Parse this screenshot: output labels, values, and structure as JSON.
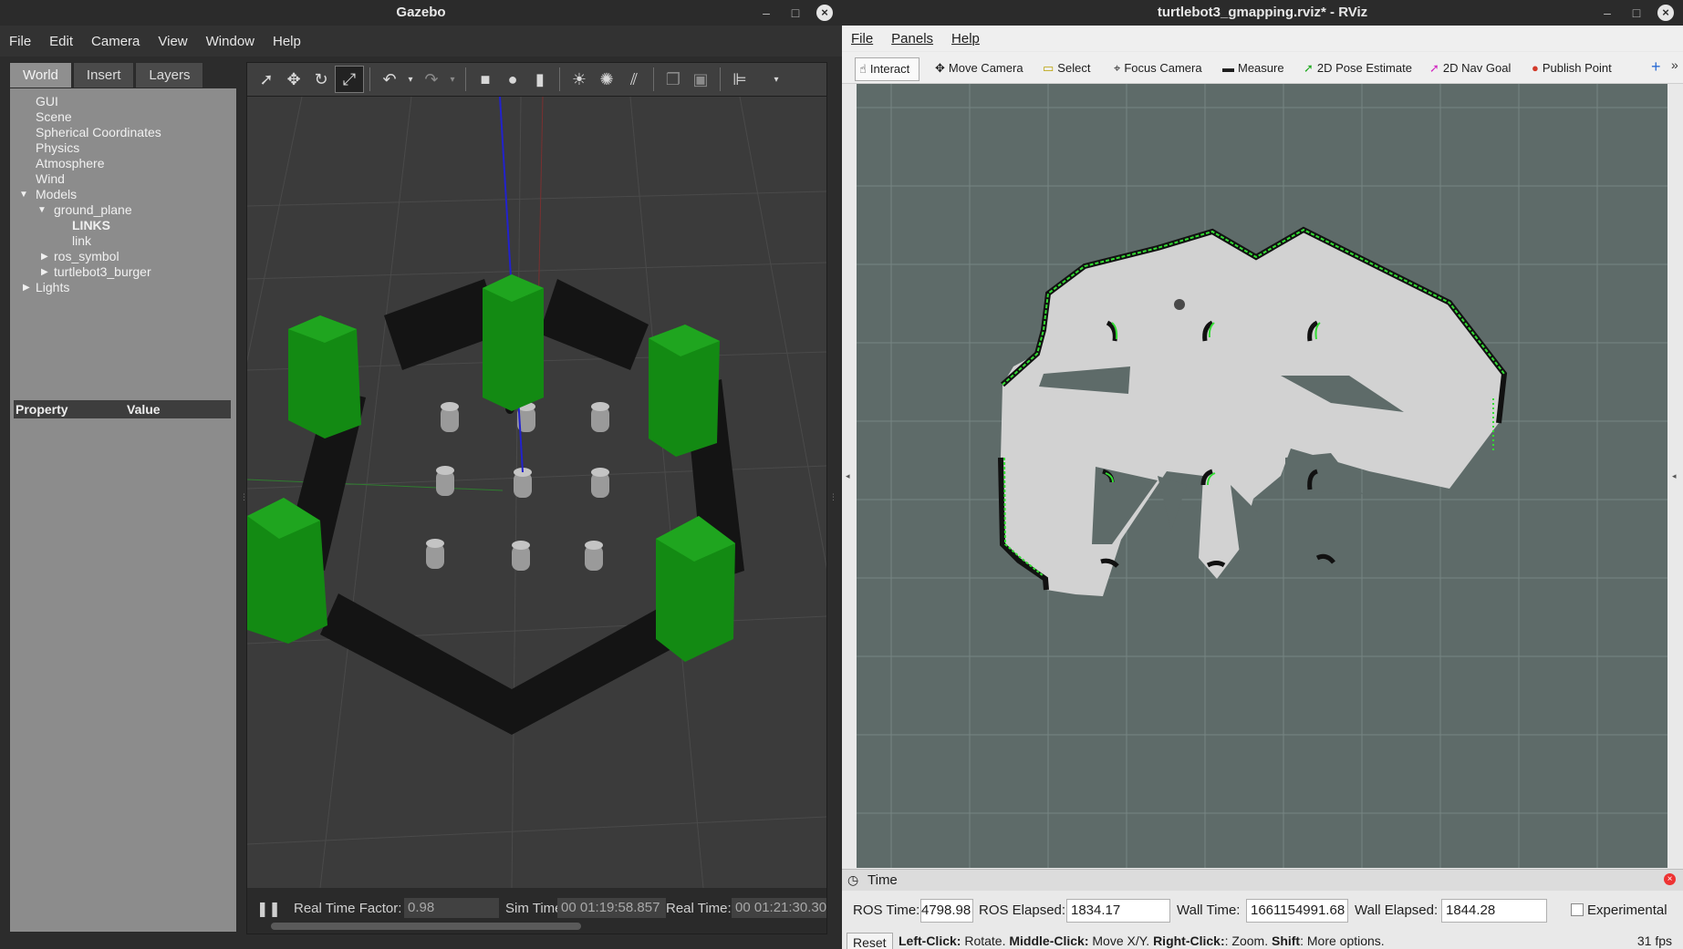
{
  "gazebo": {
    "title": "Gazebo",
    "menu": [
      "File",
      "Edit",
      "Camera",
      "View",
      "Window",
      "Help"
    ],
    "tabs": [
      "World",
      "Insert",
      "Layers"
    ],
    "tree": [
      "GUI",
      "Scene",
      "Spherical Coordinates",
      "Physics",
      "Atmosphere",
      "Wind",
      "Models",
      "ground_plane",
      "LINKS",
      "link",
      "ros_symbol",
      "turtlebot3_burger",
      "Lights"
    ],
    "property_header": "Property",
    "value_header": "Value",
    "real_time_factor_label": "Real Time Factor:",
    "real_time_factor": "0.98",
    "sim_time_label": "Sim Time:",
    "sim_time": "00 01:19:58.857",
    "real_time_label": "Real Time:",
    "real_time": "00 01:21:30.30"
  },
  "rviz": {
    "title": "turtlebot3_gmapping.rviz* - RViz",
    "menu": [
      "File",
      "Panels",
      "Help"
    ],
    "tools": [
      "Interact",
      "Move Camera",
      "Select",
      "Focus Camera",
      "Measure",
      "2D Pose Estimate",
      "2D Nav Goal",
      "Publish Point"
    ],
    "time_panel_title": "Time",
    "ros_time_label": "ROS Time:",
    "ros_time": "4798.98",
    "ros_elapsed_label": "ROS Elapsed:",
    "ros_elapsed": "1834.17",
    "wall_time_label": "Wall Time:",
    "wall_time": "1661154991.68",
    "wall_elapsed_label": "Wall Elapsed:",
    "wall_elapsed": "1844.28",
    "experimental_label": "Experimental",
    "reset_label": "Reset",
    "hint": {
      "left": "Left-Click:",
      "left_action": " Rotate. ",
      "middle": "Middle-Click:",
      "middle_action": " Move X/Y. ",
      "right": "Right-Click:",
      "right_action": ": Zoom. ",
      "shift": "Shift",
      "shift_action": ": More options."
    },
    "fps": "31 fps"
  },
  "colors": {
    "map_background": "#5e6b69",
    "map_free": "#d2d2d2",
    "map_wall": "#111111",
    "scan": "#33dd33",
    "gazebo_block": "#138a13"
  }
}
